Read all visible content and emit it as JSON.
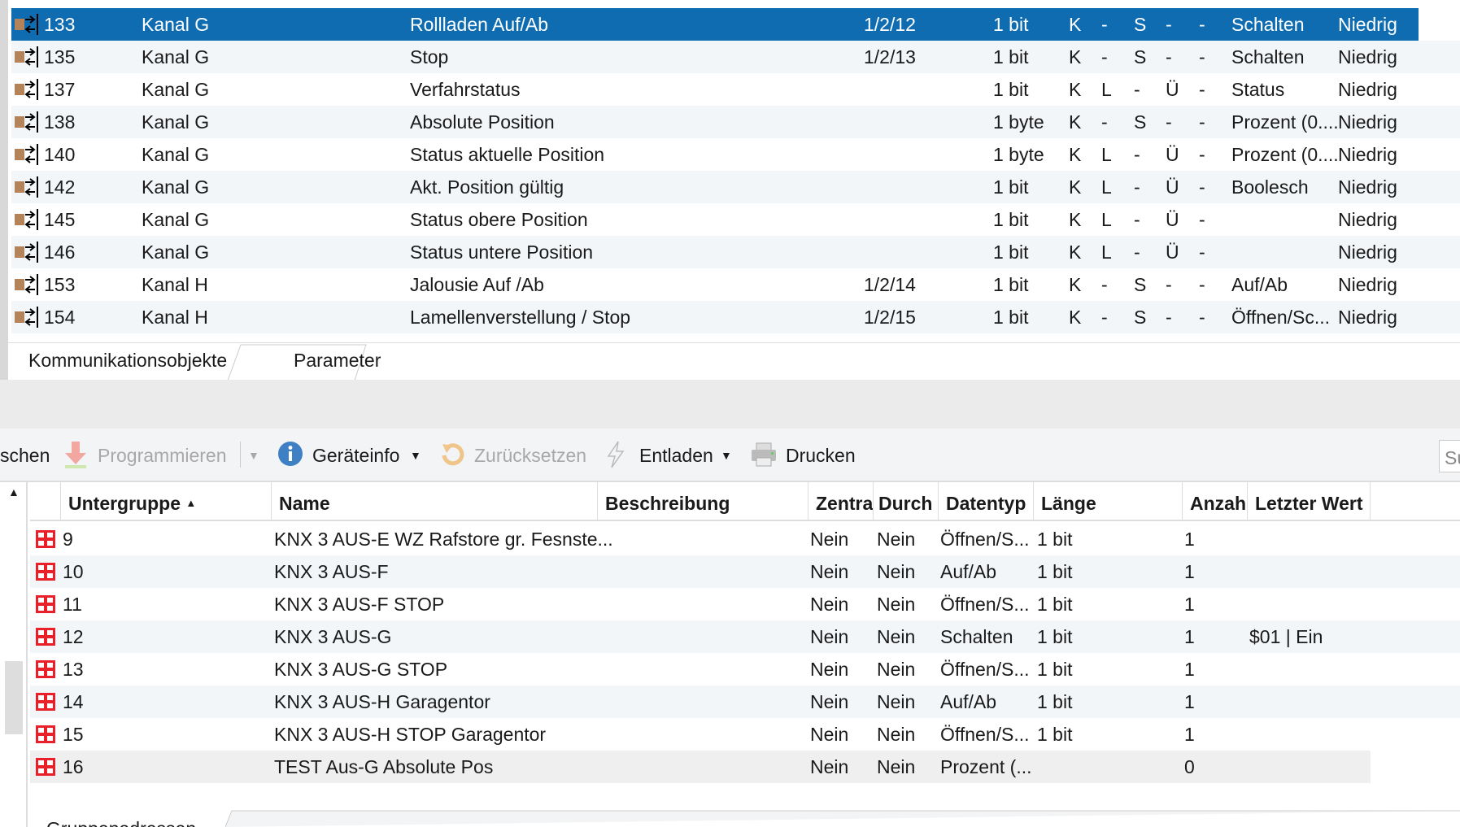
{
  "colors": {
    "selected": "#0f6cb0",
    "ga_icon": "#e8202a",
    "ko_icon": "#b5835a"
  },
  "top_table": {
    "rows": [
      {
        "num": "133",
        "channel": "Kanal G",
        "name": "Rollladen Auf/Ab",
        "ga": "1/2/12",
        "size": "1 bit",
        "k": "K",
        "l": "-",
        "s": "S",
        "u": "-",
        "a": "-",
        "datatype": "Schalten",
        "priority": "Niedrig",
        "selected": true
      },
      {
        "num": "135",
        "channel": "Kanal G",
        "name": "Stop",
        "ga": "1/2/13",
        "size": "1 bit",
        "k": "K",
        "l": "-",
        "s": "S",
        "u": "-",
        "a": "-",
        "datatype": "Schalten",
        "priority": "Niedrig"
      },
      {
        "num": "137",
        "channel": "Kanal G",
        "name": "Verfahrstatus",
        "ga": "",
        "size": "1 bit",
        "k": "K",
        "l": "L",
        "s": "-",
        "u": "Ü",
        "a": "-",
        "datatype": "Status",
        "priority": "Niedrig"
      },
      {
        "num": "138",
        "channel": "Kanal G",
        "name": "Absolute Position",
        "ga": "",
        "size": "1 byte",
        "k": "K",
        "l": "-",
        "s": "S",
        "u": "-",
        "a": "-",
        "datatype": "Prozent (0....",
        "priority": "Niedrig"
      },
      {
        "num": "140",
        "channel": "Kanal G",
        "name": "Status aktuelle Position",
        "ga": "",
        "size": "1 byte",
        "k": "K",
        "l": "L",
        "s": "-",
        "u": "Ü",
        "a": "-",
        "datatype": "Prozent (0....",
        "priority": "Niedrig"
      },
      {
        "num": "142",
        "channel": "Kanal G",
        "name": "Akt. Position gültig",
        "ga": "",
        "size": "1 bit",
        "k": "K",
        "l": "L",
        "s": "-",
        "u": "Ü",
        "a": "-",
        "datatype": "Boolesch",
        "priority": "Niedrig"
      },
      {
        "num": "145",
        "channel": "Kanal G",
        "name": "Status obere Position",
        "ga": "",
        "size": "1 bit",
        "k": "K",
        "l": "L",
        "s": "-",
        "u": "Ü",
        "a": "-",
        "datatype": "",
        "priority": "Niedrig"
      },
      {
        "num": "146",
        "channel": "Kanal G",
        "name": "Status untere Position",
        "ga": "",
        "size": "1 bit",
        "k": "K",
        "l": "L",
        "s": "-",
        "u": "Ü",
        "a": "-",
        "datatype": "",
        "priority": "Niedrig"
      },
      {
        "num": "153",
        "channel": "Kanal H",
        "name": "Jalousie Auf /Ab",
        "ga": "1/2/14",
        "size": "1 bit",
        "k": "K",
        "l": "-",
        "s": "S",
        "u": "-",
        "a": "-",
        "datatype": "Auf/Ab",
        "priority": "Niedrig"
      },
      {
        "num": "154",
        "channel": "Kanal H",
        "name": "Lamellenverstellung / Stop",
        "ga": "1/2/15",
        "size": "1 bit",
        "k": "K",
        "l": "-",
        "s": "S",
        "u": "-",
        "a": "-",
        "datatype": "Öffnen/Sc...",
        "priority": "Niedrig"
      }
    ]
  },
  "tabs": {
    "komm": "Kommunikationsobjekte",
    "param": "Parameter"
  },
  "toolbar": {
    "loeschen": "schen",
    "programmieren": "Programmieren",
    "geraeteinfo": "Geräteinfo",
    "zuruecksetzen": "Zurücksetzen",
    "entladen": "Entladen",
    "drucken": "Drucken",
    "search_placeholder": "Su"
  },
  "lower_table": {
    "headers": {
      "untergruppe": "Untergruppe",
      "name": "Name",
      "beschreibung": "Beschreibung",
      "zentral": "Zentra",
      "durch": "Durch",
      "datentyp": "Datentyp",
      "laenge": "Länge",
      "anzahl": "Anzah",
      "letzter": "Letzter Wert"
    },
    "rows": [
      {
        "num": "9",
        "name": "KNX 3 AUS-E WZ Rafstore gr. Fesnste...",
        "zentral": "Nein",
        "durch": "Nein",
        "datatype": "Öffnen/S...",
        "length": "1 bit",
        "count": "1",
        "last": ""
      },
      {
        "num": "10",
        "name": "KNX 3 AUS-F",
        "zentral": "Nein",
        "durch": "Nein",
        "datatype": "Auf/Ab",
        "length": "1 bit",
        "count": "1",
        "last": ""
      },
      {
        "num": "11",
        "name": "KNX 3 AUS-F STOP",
        "zentral": "Nein",
        "durch": "Nein",
        "datatype": "Öffnen/S...",
        "length": "1 bit",
        "count": "1",
        "last": ""
      },
      {
        "num": "12",
        "name": "KNX 3 AUS-G",
        "zentral": "Nein",
        "durch": "Nein",
        "datatype": "Schalten",
        "length": "1 bit",
        "count": "1",
        "last": "$01 | Ein"
      },
      {
        "num": "13",
        "name": "KNX 3 AUS-G STOP",
        "zentral": "Nein",
        "durch": "Nein",
        "datatype": "Öffnen/S...",
        "length": "1 bit",
        "count": "1",
        "last": ""
      },
      {
        "num": "14",
        "name": "KNX 3 AUS-H Garagentor",
        "zentral": "Nein",
        "durch": "Nein",
        "datatype": "Auf/Ab",
        "length": "1 bit",
        "count": "1",
        "last": ""
      },
      {
        "num": "15",
        "name": "KNX 3 AUS-H STOP Garagentor",
        "zentral": "Nein",
        "durch": "Nein",
        "datatype": "Öffnen/S...",
        "length": "1 bit",
        "count": "1",
        "last": ""
      },
      {
        "num": "16",
        "name": "TEST Aus-G Absolute Pos",
        "zentral": "Nein",
        "durch": "Nein",
        "datatype": "Prozent (...",
        "length": "",
        "count": "0",
        "last": ""
      }
    ]
  },
  "bottom_tab": {
    "label": "Gruppenadressen"
  }
}
